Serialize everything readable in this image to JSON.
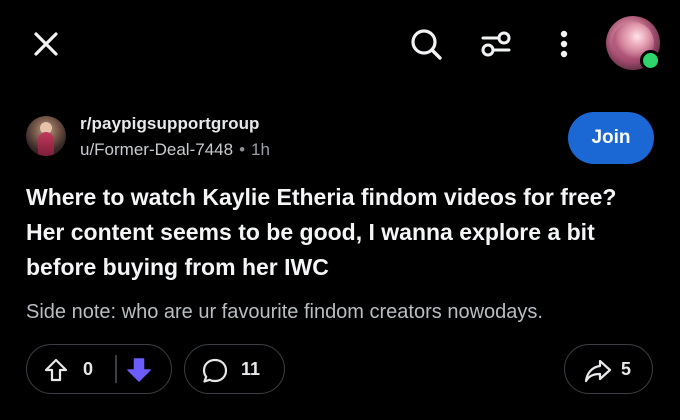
{
  "topbar": {
    "icons": [
      "close-icon",
      "search-icon",
      "filter-icon",
      "more-vertical-icon",
      "profile-avatar"
    ],
    "online_status_color": "#2fd46b"
  },
  "post": {
    "subreddit": "r/paypigsupportgroup",
    "author": "u/Former-Deal-7448",
    "separator": "•",
    "time": "1h",
    "join_label": "Join",
    "title": "Where to watch Kaylie Etheria findom videos for free? Her content seems to be good, I wanna explore a bit before buying from her IWC",
    "body": "Side note: who are ur favourite findom creators nowodays."
  },
  "actions": {
    "score": "0",
    "comments": "11",
    "shares": "5",
    "downvote_color": "#6a5cff",
    "join_color": "#1b67d3"
  }
}
